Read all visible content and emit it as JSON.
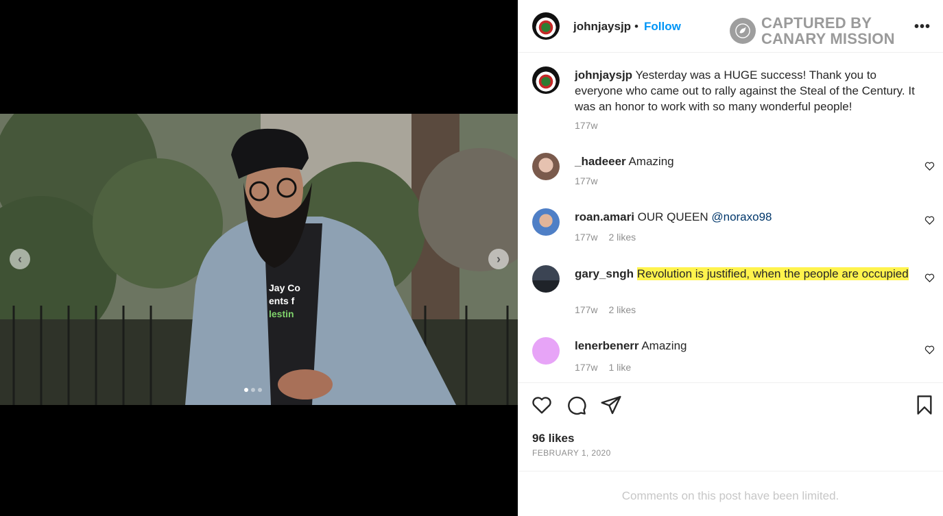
{
  "post": {
    "username": "johnjaysjp",
    "separator": "•",
    "follow_label": "Follow",
    "more_label": "•••",
    "watermark": {
      "line1": "CAPTURED BY",
      "line2": "CANARY MISSION"
    },
    "photo_shirt_text": [
      "Jay Co",
      "ents f",
      "lestin"
    ]
  },
  "carousel": {
    "prev": "‹",
    "next": "›",
    "active_index": 0,
    "count": 3
  },
  "caption": {
    "username": "johnjaysjp",
    "text": "Yesterday was a HUGE success! Thank you to everyone who came out to rally against the Steal of the Century. It was an honor to work with so many wonderful people!",
    "time": "177w"
  },
  "comments": [
    {
      "username": "_hadeeer",
      "text": "Amazing",
      "time": "177w",
      "likes": ""
    },
    {
      "username": "roan.amari",
      "text": "OUR QUEEN ",
      "mention": "@noraxo98",
      "time": "177w",
      "likes": "2 likes"
    },
    {
      "username": "gary_sngh",
      "text": "Revolution is justified, when the people are occupied",
      "time": "177w",
      "likes": "2 likes"
    },
    {
      "username": "lenerbenerr",
      "text": "Amazing",
      "time": "177w",
      "likes": "1 like"
    }
  ],
  "actions": {
    "like": "heart-icon",
    "comment": "comment-icon",
    "share": "share-icon",
    "save": "bookmark-icon"
  },
  "likes_count": "96 likes",
  "date": "FEBRUARY 1, 2020",
  "comments_limited": "Comments on this post have been limited.",
  "colors": {
    "link": "#0095f6",
    "highlight": "#fff34d",
    "muted": "#8e8e8e",
    "avatar_lenerbenerr": "#e7a4f7"
  }
}
